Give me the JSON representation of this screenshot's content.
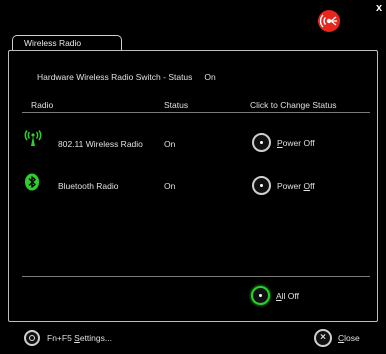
{
  "window": {
    "close_glyph": "x",
    "logo_icon": "wireless-logo-icon",
    "accent_color": "#e8261c"
  },
  "tab": {
    "label": "Wireless Radio"
  },
  "hardware": {
    "label": "Hardware Wireless Radio Switch - Status",
    "value": "On"
  },
  "columns": {
    "radio": "Radio",
    "status": "Status",
    "change": "Click to Change Status"
  },
  "rows": [
    {
      "icon": "wifi-antenna-icon",
      "name": "802.11 Wireless Radio",
      "status": "On",
      "action_prefix": "",
      "action_mnemonic": "P",
      "action_suffix": "ower Off"
    },
    {
      "icon": "bluetooth-icon",
      "name": "Bluetooth Radio",
      "status": "On",
      "action_prefix": "Power ",
      "action_mnemonic": "O",
      "action_suffix": "ff"
    }
  ],
  "all_off": {
    "mnemonic": "A",
    "rest": "ll Off",
    "color": "#2ecc2e"
  },
  "footer": {
    "settings_prefix": "Fn+F5 ",
    "settings_mnemonic": "S",
    "settings_suffix": "ettings...",
    "close_mnemonic": "C",
    "close_suffix": "lose"
  }
}
